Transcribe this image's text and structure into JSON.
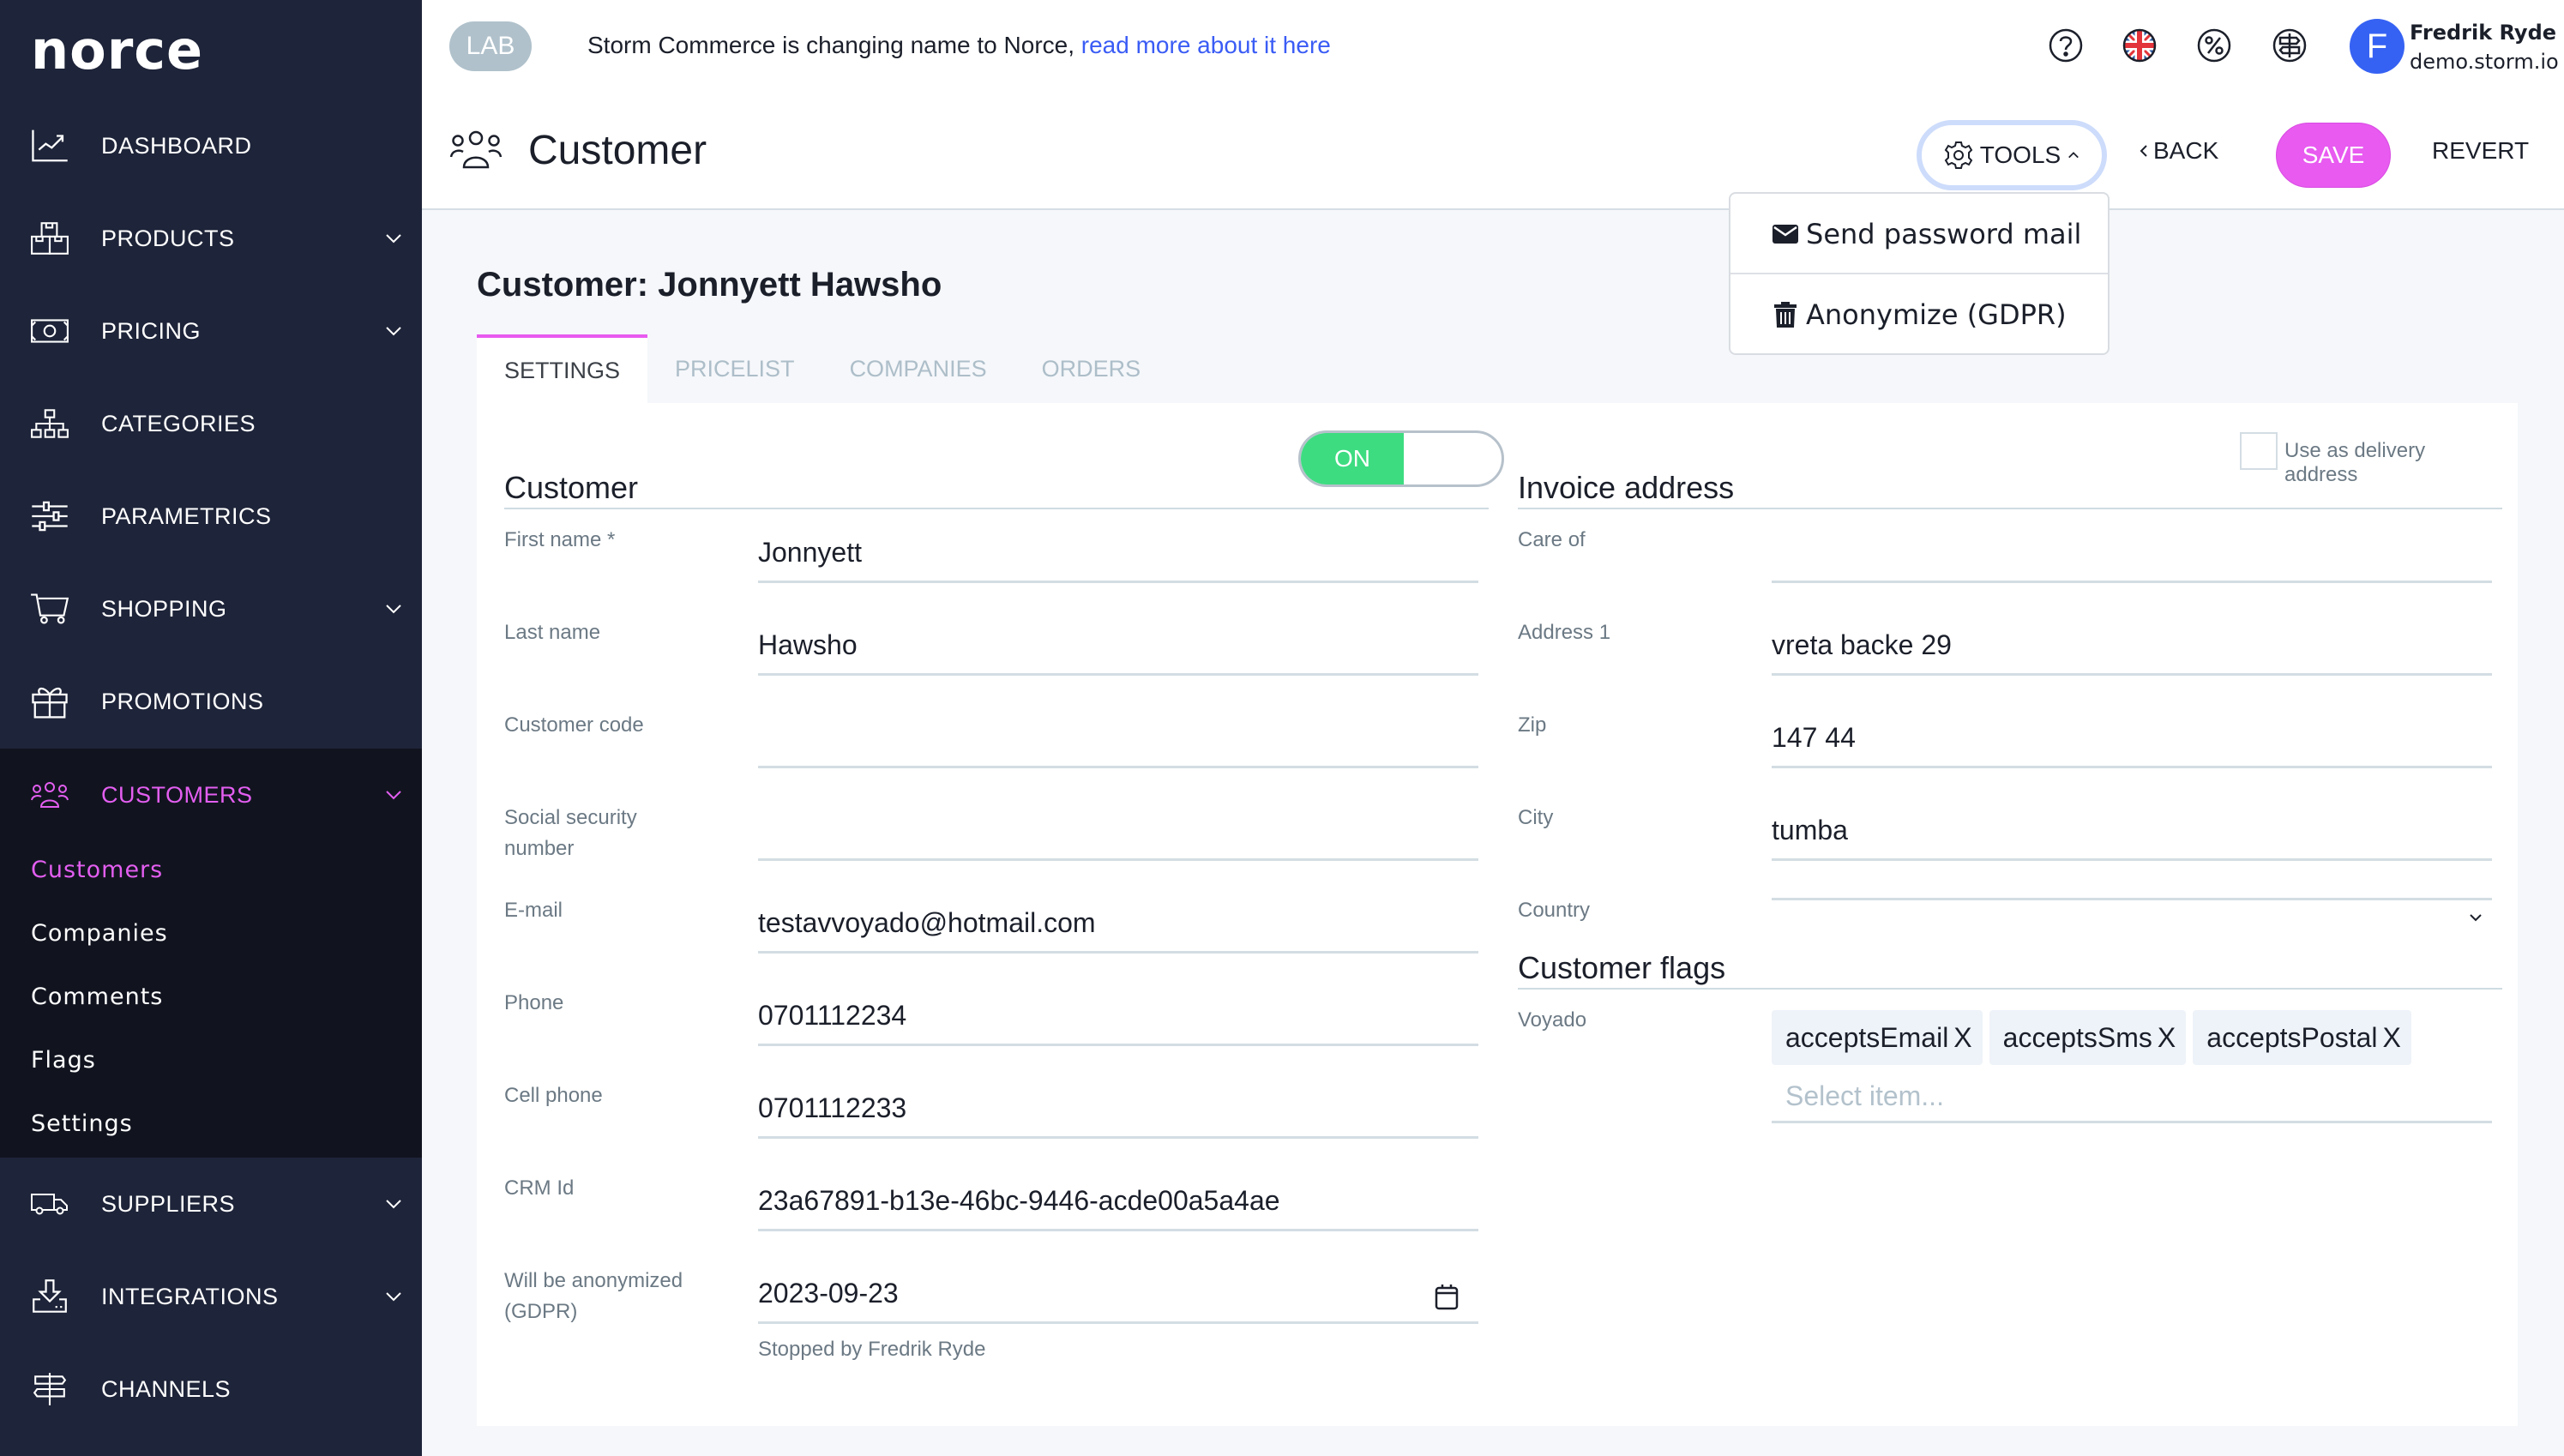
{
  "sidebar": {
    "logo": "norce",
    "items": [
      {
        "label": "DASHBOARD",
        "icon": "chart-icon",
        "expandable": false
      },
      {
        "label": "PRODUCTS",
        "icon": "boxes-icon",
        "expandable": true
      },
      {
        "label": "PRICING",
        "icon": "banknote-icon",
        "expandable": true
      },
      {
        "label": "CATEGORIES",
        "icon": "hierarchy-icon",
        "expandable": false
      },
      {
        "label": "PARAMETRICS",
        "icon": "sliders-icon",
        "expandable": false
      },
      {
        "label": "SHOPPING",
        "icon": "cart-icon",
        "expandable": true
      },
      {
        "label": "PROMOTIONS",
        "icon": "gift-icon",
        "expandable": false
      },
      {
        "label": "CUSTOMERS",
        "icon": "users-icon",
        "expandable": true,
        "active": true
      },
      {
        "label": "SUPPLIERS",
        "icon": "truck-icon",
        "expandable": true
      },
      {
        "label": "INTEGRATIONS",
        "icon": "inbox-download-icon",
        "expandable": true
      },
      {
        "label": "CHANNELS",
        "icon": "signpost-icon",
        "expandable": false
      }
    ],
    "customers_sub": [
      {
        "label": "Customers",
        "active": true
      },
      {
        "label": "Companies"
      },
      {
        "label": "Comments"
      },
      {
        "label": "Flags"
      },
      {
        "label": "Settings"
      }
    ]
  },
  "topbar": {
    "badge": "LAB",
    "announcement": "Storm Commerce is changing name to Norce,",
    "announcement_link": "read more about it here",
    "icons": [
      "help-icon",
      "uk-flag-icon",
      "percent-icon",
      "signpost-icon"
    ],
    "user": {
      "initial": "F",
      "name": "Fredrik Ryde",
      "domain": "demo.storm.io"
    }
  },
  "page_header": {
    "title": "Customer",
    "tools_label": "TOOLS",
    "back_label": "BACK",
    "save_label": "SAVE",
    "revert_label": "REVERT"
  },
  "tools_menu": {
    "items": [
      {
        "label": "Send password mail",
        "icon": "envelope-icon"
      },
      {
        "label": "Anonymize (GDPR)",
        "icon": "trash-icon"
      }
    ]
  },
  "content": {
    "heading": "Customer: Jonnyett Hawsho",
    "tabs": [
      {
        "label": "SETTINGS",
        "active": true
      },
      {
        "label": "PRICELIST"
      },
      {
        "label": "COMPANIES"
      },
      {
        "label": "ORDERS"
      }
    ],
    "customer": {
      "title": "Customer",
      "active_toggle": "ON",
      "fields": [
        {
          "label": "First name *",
          "value": "Jonnyett"
        },
        {
          "label": "Last name",
          "value": "Hawsho"
        },
        {
          "label": "Customer code",
          "value": ""
        },
        {
          "label": "Social security number",
          "value": ""
        },
        {
          "label": "E-mail",
          "value": "testavvoyado@hotmail.com"
        },
        {
          "label": "Phone",
          "value": "0701112234"
        },
        {
          "label": "Cell phone",
          "value": "0701112233"
        },
        {
          "label": "CRM Id",
          "value": "23a67891-b13e-46bc-9446-acde00a5a4ae"
        },
        {
          "label": "Will be anonymized (GDPR)",
          "value": "2023-09-23",
          "helper": "Stopped by Fredrik Ryde"
        }
      ]
    },
    "invoice": {
      "title": "Invoice address",
      "delivery_checkbox_label": "Use as delivery address",
      "delivery_checked": false,
      "fields": [
        {
          "label": "Care of",
          "value": ""
        },
        {
          "label": "Address 1",
          "value": "vreta backe 29"
        },
        {
          "label": "Zip",
          "value": "147 44"
        },
        {
          "label": "City",
          "value": "tumba"
        },
        {
          "label": "Country",
          "value": ""
        }
      ]
    },
    "flags": {
      "title": "Customer flags",
      "group_label": "Voyado",
      "tags": [
        "acceptsEmail",
        "acceptsSms",
        "acceptsPostal"
      ],
      "remove_glyph": "X",
      "placeholder": "Select item..."
    }
  },
  "colors": {
    "sidebar_bg": "#1e2439",
    "sidebar_active_bg": "#11141f",
    "accent": "#e85af0",
    "link": "#3a5cf5",
    "toggle_on": "#3ddc81",
    "avatar": "#3662f3"
  }
}
